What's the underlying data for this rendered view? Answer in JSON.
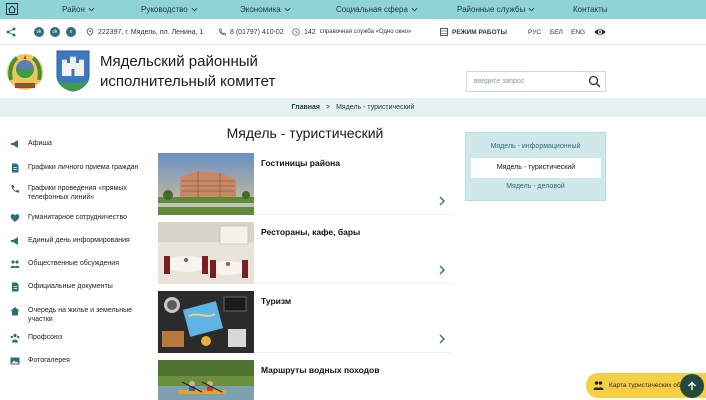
{
  "topnav": {
    "items": [
      {
        "label": "Район",
        "has_dropdown": true
      },
      {
        "label": "Руководство",
        "has_dropdown": true
      },
      {
        "label": "Экономика",
        "has_dropdown": true
      },
      {
        "label": "Социальная сфера",
        "has_dropdown": true
      },
      {
        "label": "Районные службы",
        "has_dropdown": true
      },
      {
        "label": "Контакты",
        "has_dropdown": false
      }
    ],
    "bg_color": "#8fd3d7"
  },
  "infobar": {
    "address": "222397, г. Мядель, пл. Ленина, 1",
    "phone": "8 (01797) 410-02",
    "hotline_number": "142",
    "hotline_label": "справочная служба «Одно окно»",
    "work_hours": "РЕЖИМ РАБОТЫ",
    "languages": [
      "РУС",
      "БЕЛ",
      "ENG"
    ],
    "social": [
      "share-icon",
      "vk-icon",
      "ok-icon",
      "viber-icon"
    ]
  },
  "brand": {
    "org_name": "Мядельский районный исполнительный комитет"
  },
  "search": {
    "placeholder": "введите запрос"
  },
  "breadcrumb": {
    "home": "Главная",
    "separator": ">",
    "current": "Мядель - туристический"
  },
  "sidebar": {
    "items": [
      {
        "label": "Афиша",
        "icon": "megaphone-icon"
      },
      {
        "label": "Графики личного приема граждан",
        "icon": "document-icon"
      },
      {
        "label": "Графики проведения «прямых телефонных линий»",
        "icon": "phone-icon"
      },
      {
        "label": "Гуманитарное сотрудничество",
        "icon": "heart-icon"
      },
      {
        "label": "Единый день информирования",
        "icon": "megaphone-icon"
      },
      {
        "label": "Общественные обсуждения",
        "icon": "people-icon"
      },
      {
        "label": "Официальные документы",
        "icon": "document-icon"
      },
      {
        "label": "Очередь на жилье и земельные участки",
        "icon": "house-icon"
      },
      {
        "label": "Профсоюз",
        "icon": "group-icon"
      },
      {
        "label": "Фотогалерея",
        "icon": "image-icon"
      }
    ]
  },
  "main": {
    "title": "Мядель - туристический",
    "cards": [
      {
        "title": "Гостиницы района",
        "image": "hotel-photo"
      },
      {
        "title": "Рестораны, кафе, бары",
        "image": "restaurant-photo"
      },
      {
        "title": "Туризм",
        "image": "travel-items-photo"
      },
      {
        "title": "Маршруты водных походов",
        "image": "kayak-photo"
      }
    ]
  },
  "right_panel": {
    "links": [
      {
        "label": "Мядель - информационный",
        "active": false
      },
      {
        "label": "Мядель - туристический",
        "active": true
      },
      {
        "label": "Мядель - деловой",
        "active": false
      }
    ]
  },
  "floating": {
    "tour_map_label": "Карта туристических объектов"
  },
  "colors": {
    "accent": "#2d6f7a",
    "nav_bg": "#8fd3d7",
    "breadcrumb_bg": "#e5f1f2",
    "map_button": "#f6cf45",
    "up_button": "#234b3d"
  }
}
